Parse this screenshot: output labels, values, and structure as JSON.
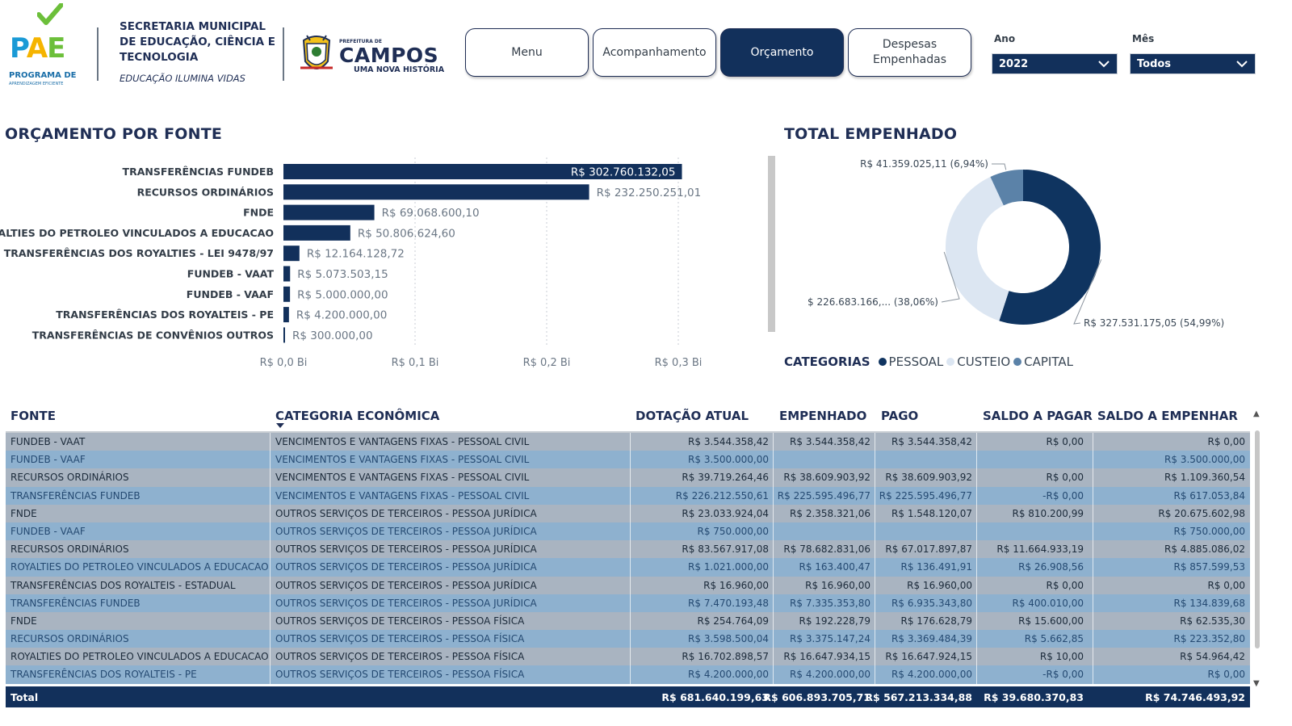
{
  "header": {
    "pae_letters": [
      "P",
      "A",
      "E"
    ],
    "pae_line1": "PROGRAMA DE",
    "pae_line2": "APRENDIZAGEM EFICIENTE",
    "secretaria": "SECRETARIA MUNICIPAL DE EDUCAÇÃO, CIÊNCIA E TECNOLOGIA",
    "tagline": "EDUCAÇÃO ILUMINA VIDAS",
    "prefeitura_small": "PREFEITURA DE",
    "prefeitura_big": "CAMPOS",
    "prefeitura_tag": "UMA NOVA HISTÓRIA"
  },
  "nav": {
    "menu": "Menu",
    "acompanhamento": "Acompanhamento",
    "orcamento": "Orçamento",
    "despesas": "Despesas Empenhadas"
  },
  "filters": {
    "ano_label": "Ano",
    "ano_value": "2022",
    "mes_label": "Mês",
    "mes_value": "Todos"
  },
  "colors": {
    "navy": "#12305b",
    "pessoal": "#0f3460",
    "custeio": "#dce6f2",
    "capital": "#5b82a8"
  },
  "bar_section": {
    "title": "ORÇAMENTO POR FONTE"
  },
  "donut_section": {
    "title": "TOTAL EMPENHADO"
  },
  "chart_data": [
    {
      "type": "bar",
      "orientation": "horizontal",
      "title": "ORÇAMENTO POR FONTE",
      "categories": [
        "TRANSFERÊNCIAS FUNDEB",
        "RECURSOS ORDINÁRIOS",
        "FNDE",
        "ROYALTIES DO PETROLEO VINCULADOS A EDUCACAO",
        "TRANSFERÊNCIAS DOS ROYALTIES - LEI 9478/97",
        "FUNDEB - VAAT",
        "FUNDEB - VAAF",
        "TRANSFERÊNCIAS DOS ROYALTEIS - PE",
        "TRANSFERÊNCIAS DE CONVÊNIOS OUTROS"
      ],
      "values": [
        302760132.05,
        232250251.01,
        69068600.1,
        50806624.6,
        12164128.72,
        5073503.15,
        5000000.0,
        4200000.0,
        300000.0
      ],
      "data_labels": [
        "R$ 302.760.132,05",
        "R$ 232.250.251,01",
        "R$ 69.068.600,10",
        "R$ 50.806.624,60",
        "R$ 12.164.128,72",
        "R$ 5.073.503,15",
        "R$ 5.000.000,00",
        "R$ 4.200.000,00",
        "R$ 300.000,00"
      ],
      "x_ticks": [
        0,
        100000000,
        200000000,
        300000000
      ],
      "x_tick_labels": [
        "R$ 0,0 Bi",
        "R$ 0,1 Bi",
        "R$ 0,2 Bi",
        "R$ 0,3 Bi"
      ],
      "xlim": [
        0,
        300000000
      ],
      "grid": true
    },
    {
      "type": "pie",
      "donut": true,
      "title": "TOTAL EMPENHADO",
      "legend_title": "CATEGORIAS",
      "legend_position": "bottom",
      "categories": [
        "PESSOAL",
        "CUSTEIO",
        "CAPITAL"
      ],
      "values": [
        327531175.05,
        226683166.0,
        41359025.11
      ],
      "percent": [
        54.99,
        38.06,
        6.94
      ],
      "data_labels": [
        "R$ 327.531.175,05 (54,99%)",
        "R$ 226.683.166,... (38,06%)",
        "R$ 41.359.025,11 (6,94%)"
      ]
    }
  ],
  "table": {
    "headers": [
      "FONTE",
      "CATEGORIA ECONÔMICA",
      "DOTAÇÃO ATUAL",
      "EMPENHADO",
      "PAGO",
      "SALDO A PAGAR",
      "SALDO A EMPENHAR"
    ],
    "rows": [
      [
        "FUNDEB - VAAT",
        "VENCIMENTOS E VANTAGENS FIXAS - PESSOAL CIVIL",
        "R$ 3.544.358,42",
        "R$ 3.544.358,42",
        "R$ 3.544.358,42",
        "R$ 0,00",
        "R$ 0,00"
      ],
      [
        "FUNDEB - VAAF",
        "VENCIMENTOS E VANTAGENS FIXAS - PESSOAL CIVIL",
        "R$ 3.500.000,00",
        "",
        "",
        "",
        "R$ 3.500.000,00"
      ],
      [
        "RECURSOS ORDINÁRIOS",
        "VENCIMENTOS E VANTAGENS FIXAS - PESSOAL CIVIL",
        "R$ 39.719.264,46",
        "R$ 38.609.903,92",
        "R$ 38.609.903,92",
        "R$ 0,00",
        "R$ 1.109.360,54"
      ],
      [
        "TRANSFERÊNCIAS FUNDEB",
        "VENCIMENTOS E VANTAGENS FIXAS - PESSOAL CIVIL",
        "R$ 226.212.550,61",
        "R$ 225.595.496,77",
        "R$ 225.595.496,77",
        "-R$ 0,00",
        "R$ 617.053,84"
      ],
      [
        "FNDE",
        "OUTROS SERVIÇOS DE TERCEIROS - PESSOA JURÍDICA",
        "R$ 23.033.924,04",
        "R$ 2.358.321,06",
        "R$ 1.548.120,07",
        "R$ 810.200,99",
        "R$ 20.675.602,98"
      ],
      [
        "FUNDEB - VAAF",
        "OUTROS SERVIÇOS DE TERCEIROS - PESSOA JURÍDICA",
        "R$ 750.000,00",
        "",
        "",
        "",
        "R$ 750.000,00"
      ],
      [
        "RECURSOS ORDINÁRIOS",
        "OUTROS SERVIÇOS DE TERCEIROS - PESSOA JURÍDICA",
        "R$ 83.567.917,08",
        "R$ 78.682.831,06",
        "R$ 67.017.897,87",
        "R$ 11.664.933,19",
        "R$ 4.885.086,02"
      ],
      [
        "ROYALTIES DO PETROLEO VINCULADOS A EDUCACAO",
        "OUTROS SERVIÇOS DE TERCEIROS - PESSOA JURÍDICA",
        "R$ 1.021.000,00",
        "R$ 163.400,47",
        "R$ 136.491,91",
        "R$ 26.908,56",
        "R$ 857.599,53"
      ],
      [
        "TRANSFERÊNCIAS DOS ROYALTEIS - ESTADUAL",
        "OUTROS SERVIÇOS DE TERCEIROS - PESSOA JURÍDICA",
        "R$ 16.960,00",
        "R$ 16.960,00",
        "R$ 16.960,00",
        "R$ 0,00",
        "R$ 0,00"
      ],
      [
        "TRANSFERÊNCIAS FUNDEB",
        "OUTROS SERVIÇOS DE TERCEIROS - PESSOA JURÍDICA",
        "R$ 7.470.193,48",
        "R$ 7.335.353,80",
        "R$ 6.935.343,80",
        "R$ 400.010,00",
        "R$ 134.839,68"
      ],
      [
        "FNDE",
        "OUTROS SERVIÇOS DE TERCEIROS - PESSOA FÍSICA",
        "R$ 254.764,09",
        "R$ 192.228,79",
        "R$ 176.628,79",
        "R$ 15.600,00",
        "R$ 62.535,30"
      ],
      [
        "RECURSOS ORDINÁRIOS",
        "OUTROS SERVIÇOS DE TERCEIROS - PESSOA FÍSICA",
        "R$ 3.598.500,04",
        "R$ 3.375.147,24",
        "R$ 3.369.484,39",
        "R$ 5.662,85",
        "R$ 223.352,80"
      ],
      [
        "ROYALTIES DO PETROLEO VINCULADOS A EDUCACAO",
        "OUTROS SERVIÇOS DE TERCEIROS - PESSOA FÍSICA",
        "R$ 16.702.898,57",
        "R$ 16.647.934,15",
        "R$ 16.647.924,15",
        "R$ 10,00",
        "R$ 54.964,42"
      ],
      [
        "TRANSFERÊNCIAS DOS ROYALTEIS - PE",
        "OUTROS SERVIÇOS DE TERCEIROS - PESSOA FÍSICA",
        "R$ 4.200.000,00",
        "R$ 4.200.000,00",
        "R$ 4.200.000,00",
        "-R$ 0,00",
        "R$ 0,00"
      ]
    ],
    "total": [
      "Total",
      "",
      "R$ 681.640.199,63",
      "R$ 606.893.705,71",
      "R$ 567.213.334,88",
      "R$ 39.680.370,83",
      "R$ 74.746.493,92"
    ]
  }
}
